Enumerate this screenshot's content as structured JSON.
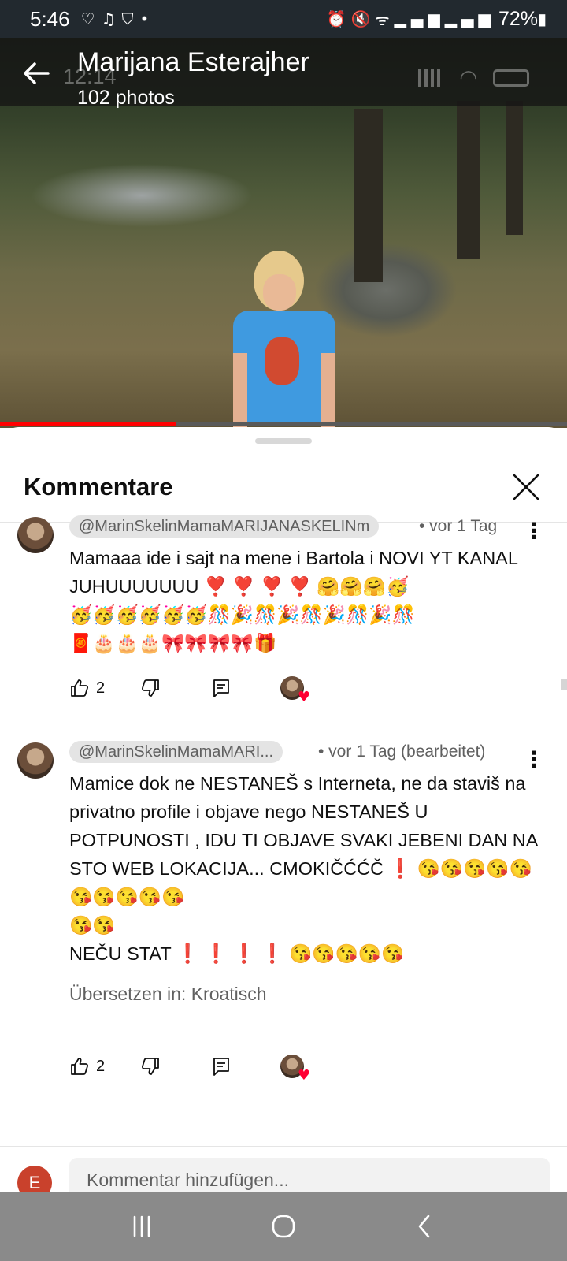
{
  "status_bar": {
    "time": "5:46",
    "left_icons": [
      "heart-shield-icon",
      "music-note-icon",
      "shield-icon",
      "dot-icon"
    ],
    "battery_percent": "72%",
    "right_icons": [
      "alarm-icon",
      "mute-icon",
      "wifi-icon",
      "signal-icon",
      "signal-icon",
      "battery-icon"
    ]
  },
  "album": {
    "title": "Marijana Esterajher",
    "subtitle": "102 photos",
    "ghost_time": "12:14"
  },
  "video": {
    "progress": 0.31,
    "progress_color": "#ff0000"
  },
  "comments_panel": {
    "title": "Kommentare",
    "comments": [
      {
        "author": "@MarinSkelinMamaMARIJANASKELINm",
        "time": "• vor 1 Tag",
        "text": "Mamaaa ide i sajt na mene i Bartola i NOVI YT KANAL JUHUUUUUUU ❣️ ❣️ ❣️ ❣️ 🤗🤗🤗🥳\n🥳🥳🥳🥳🥳🥳🎊🎉🎊🎉🎊🎉🎊🎉🎊\n🧧🎂🎂🎂🎀🎀🎀🎀🎁",
        "likes": "2"
      },
      {
        "author": "@MarinSkelinMamaMARI...",
        "time": "• vor 1 Tag (bearbeitet)",
        "text": "Mamice dok ne NESTANEŠ s Interneta,  ne da staviš na privatno profile i objave nego NESTANEŠ U POTPUNOSTI , IDU TI OBJAVE SVAKI JEBENI DAN NA STO WEB LOKACIJA... CMOKIČĆĆČ ❗ 😘😘😘😘😘😘😘😘😘😘\n😘😘\nNEČU STAT ❗ ❗ ❗ ❗ 😘😘😘😘😘",
        "translate": "Übersetzen in: Kroatisch",
        "likes": "2"
      }
    ],
    "add_comment": {
      "avatar_letter": "E",
      "placeholder": "Kommentar hinzufügen..."
    }
  },
  "colors": {
    "accent_red": "#ff0000",
    "avatar_user": "#c9412c",
    "nav_bar": "#8a8a8a"
  }
}
